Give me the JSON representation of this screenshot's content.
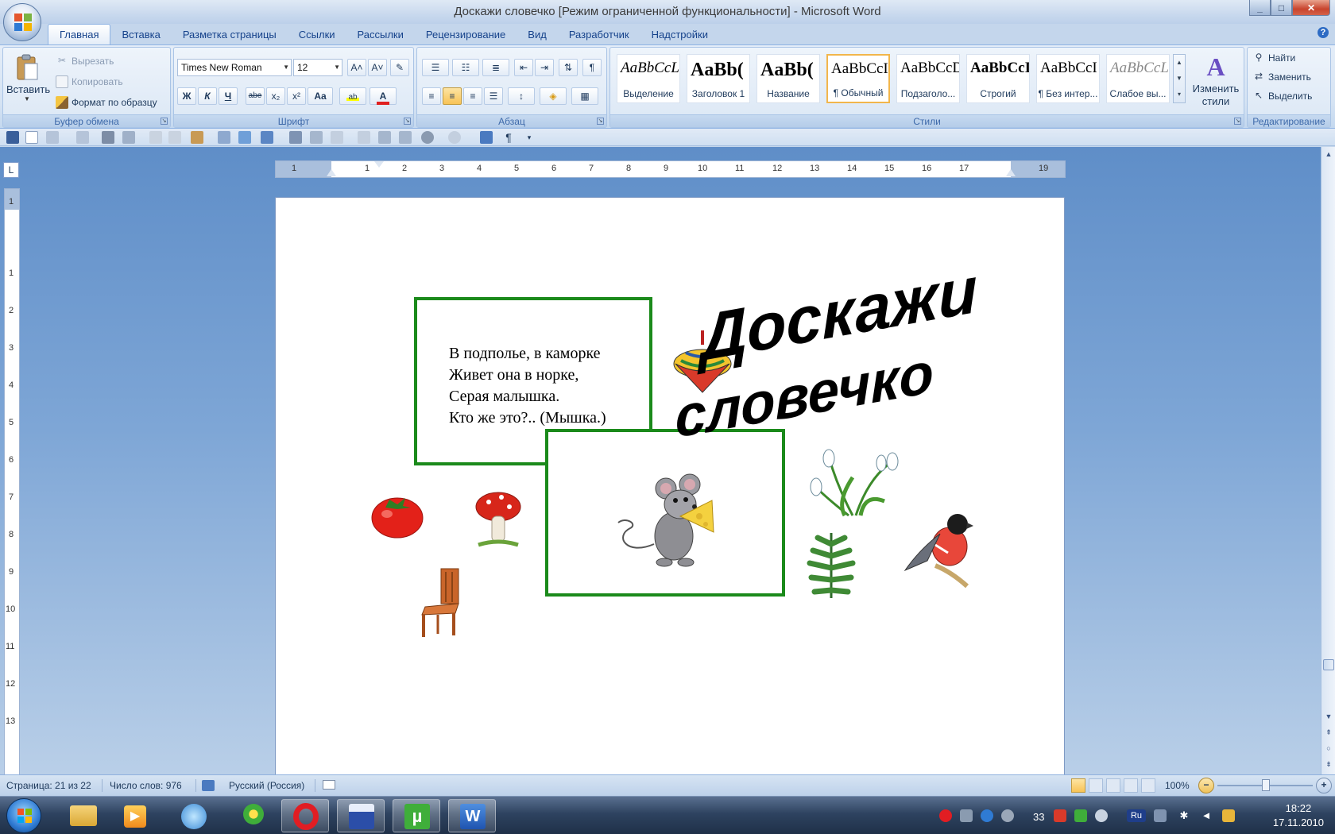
{
  "window": {
    "title": "Доскажи словечко [Режим ограниченной функциональности] - Microsoft Word",
    "minimize_glyph": "_",
    "maximize_glyph": "□",
    "close_glyph": "✕"
  },
  "tabs": [
    "Главная",
    "Вставка",
    "Разметка страницы",
    "Ссылки",
    "Рассылки",
    "Рецензирование",
    "Вид",
    "Разработчик",
    "Надстройки"
  ],
  "ribbon": {
    "clipboard": {
      "label": "Буфер обмена",
      "paste": "Вставить",
      "cut": "Вырезать",
      "copy": "Копировать",
      "format_painter": "Формат по образцу"
    },
    "font": {
      "label": "Шрифт",
      "family": "Times New Roman",
      "size": "12",
      "bold": "Ж",
      "italic": "К",
      "underline": "Ч",
      "strike": "abe",
      "subscript": "x₂",
      "superscript": "x²",
      "change_case": "Aa",
      "grow": "A˄",
      "shrink": "A˅",
      "font_color": "A"
    },
    "paragraph": {
      "label": "Абзац",
      "show_marks": "¶"
    },
    "styles": {
      "label": "Стили",
      "change_styles": "Изменить стили",
      "items": [
        {
          "sample": "AaBbCcL",
          "name": "Выделение"
        },
        {
          "sample": "AaBb(",
          "name": "Заголовок 1"
        },
        {
          "sample": "AaBb(",
          "name": "Название"
        },
        {
          "sample": "AaBbCcI",
          "name": "¶ Обычный"
        },
        {
          "sample": "AaBbCcD",
          "name": "Подзаголо..."
        },
        {
          "sample": "AaBbCcI",
          "name": "Строгий"
        },
        {
          "sample": "AaBbCcI",
          "name": "¶ Без интер..."
        },
        {
          "sample": "AaBbCcL",
          "name": "Слабое вы..."
        }
      ]
    },
    "editing": {
      "label": "Редактирование",
      "find": "Найти",
      "replace": "Заменить",
      "select": "Выделить"
    }
  },
  "ruler": {
    "corner_glyph": "L",
    "h_numbers": [
      "1",
      "1",
      "2",
      "3",
      "4",
      "5",
      "6",
      "7",
      "8",
      "9",
      "10",
      "11",
      "12",
      "13",
      "14",
      "15",
      "16",
      "17",
      "19"
    ],
    "v_numbers": [
      "1",
      "1",
      "2",
      "3",
      "4",
      "5",
      "6",
      "7",
      "8",
      "9",
      "10",
      "11",
      "12",
      "13"
    ]
  },
  "document": {
    "riddle_lines": [
      "В подполье, в каморке",
      "Живет она в норке,",
      "Серая малышка.",
      "Кто же это?.. (Мышка.)"
    ],
    "wordart_line1": "Доскажи",
    "wordart_line2": "словечко"
  },
  "statusbar": {
    "page": "Страница: 21 из 22",
    "words": "Число слов: 976",
    "language": "Русский (Россия)",
    "zoom": "100%",
    "zoom_out": "−",
    "zoom_in": "+"
  },
  "taskbar": {
    "tray_number": "33",
    "lang": "Ru",
    "time": "18:22",
    "date": "17.11.2010"
  },
  "colors": {
    "accent": "#15428b",
    "frame_green": "#1b8a1b",
    "ribbon_bg": "#dbe7f5",
    "taskbar_bg": "#2e4360"
  }
}
